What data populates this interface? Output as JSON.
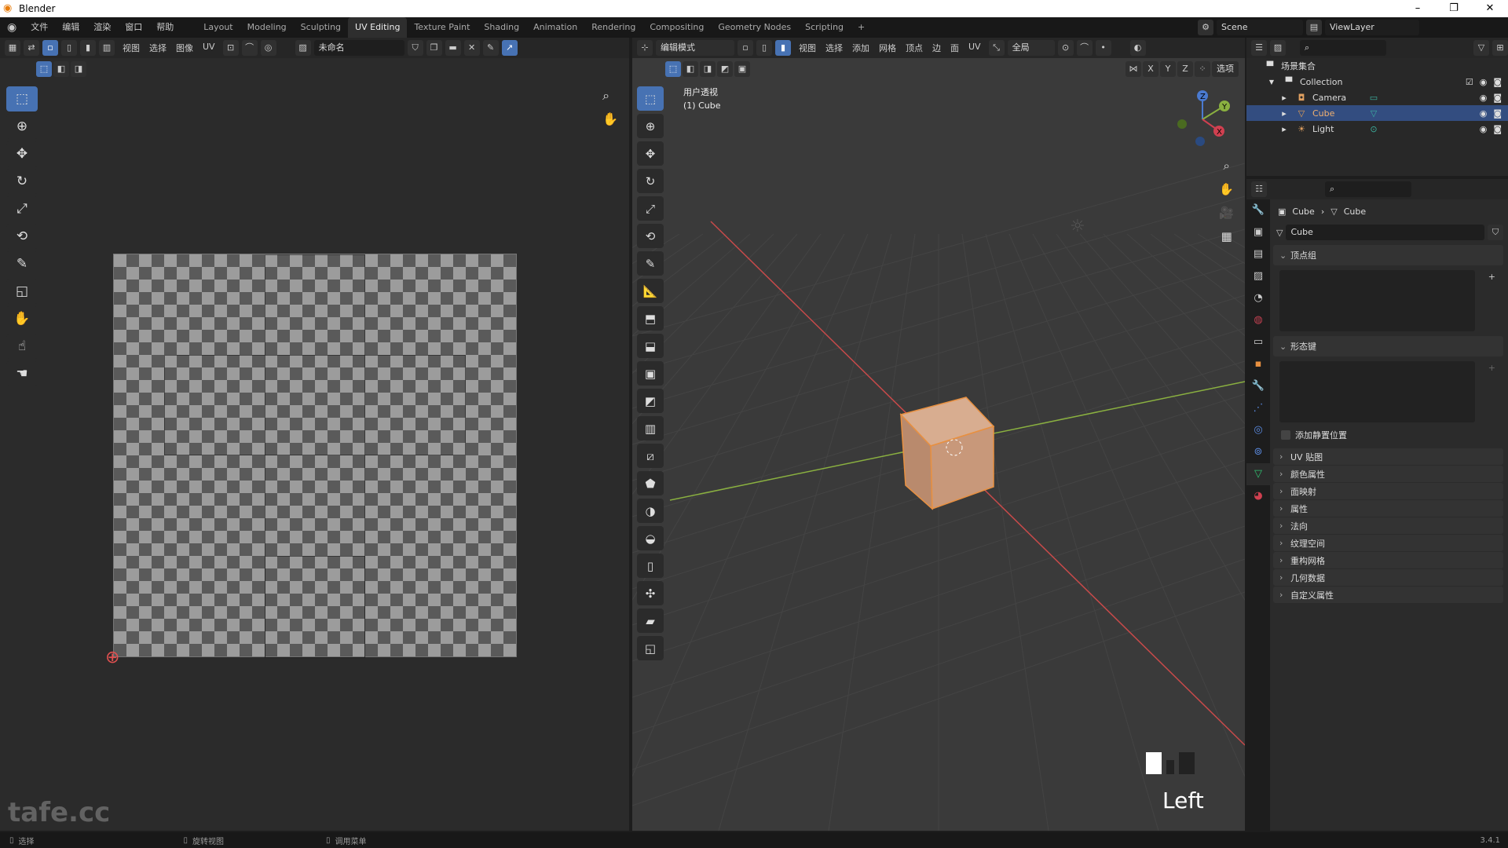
{
  "window": {
    "title": "Blender",
    "minimize": "–",
    "maximize": "❐",
    "close": "✕"
  },
  "menu": [
    "文件",
    "编辑",
    "渲染",
    "窗口",
    "帮助"
  ],
  "workspaces": [
    {
      "label": "Layout"
    },
    {
      "label": "Modeling"
    },
    {
      "label": "Sculpting"
    },
    {
      "label": "UV Editing",
      "active": true
    },
    {
      "label": "Texture Paint"
    },
    {
      "label": "Shading"
    },
    {
      "label": "Animation"
    },
    {
      "label": "Rendering"
    },
    {
      "label": "Compositing"
    },
    {
      "label": "Geometry Nodes"
    },
    {
      "label": "Scripting"
    }
  ],
  "add_workspace": "+",
  "scene": {
    "label": "Scene",
    "view_layer": "ViewLayer"
  },
  "uv_editor": {
    "menus": [
      "视图",
      "选择",
      "图像",
      "UV"
    ],
    "image_name": "未命名",
    "tools": [
      "select-box",
      "cursor",
      "move",
      "rotate",
      "scale",
      "transform",
      "annotate",
      "rip",
      "grab",
      "relax",
      "pinch"
    ]
  },
  "viewport": {
    "mode": "编辑模式",
    "menus": [
      "视图",
      "选择",
      "添加",
      "网格",
      "顶点",
      "边",
      "面",
      "UV"
    ],
    "orientation": "全局",
    "options": "选项",
    "axes": [
      "X",
      "Y",
      "Z"
    ],
    "view_name": "用户透视",
    "object_label": "(1) Cube",
    "key_hint": "Left",
    "tools": [
      "select-box",
      "cursor",
      "move",
      "rotate",
      "scale",
      "transform",
      "annotate",
      "measure",
      "add-cube",
      "extrude",
      "inset",
      "bevel",
      "loop-cut",
      "knife",
      "poly-build",
      "spin",
      "smooth",
      "edge-slide",
      "shrink",
      "shear",
      "rip"
    ]
  },
  "outliner": {
    "root": "场景集合",
    "collection": "Collection",
    "items": [
      {
        "name": "Camera",
        "color": "#e0a060"
      },
      {
        "name": "Cube",
        "color": "#e8a050",
        "selected": true
      },
      {
        "name": "Light",
        "color": "#e0a060"
      }
    ]
  },
  "properties": {
    "breadcrumb": [
      "Cube",
      "Cube"
    ],
    "mesh_name": "Cube",
    "panels_open": [
      "顶点组",
      "形态键"
    ],
    "add_rest_position": "添加静置位置",
    "panels_closed": [
      "UV 贴图",
      "颜色属性",
      "面映射",
      "属性",
      "法向",
      "纹理空间",
      "重构网格",
      "几何数据",
      "自定义属性"
    ]
  },
  "statusbar": {
    "items": [
      "选择",
      "旋转视图",
      "调用菜单"
    ],
    "version": "3.4.1"
  },
  "watermark": "tafe.cc",
  "colors": {
    "accent": "#4772b3",
    "x_axis": "#c84a4a",
    "y_axis": "#8ab040",
    "cube": "#c8987a",
    "selected_row": "#334d80"
  }
}
